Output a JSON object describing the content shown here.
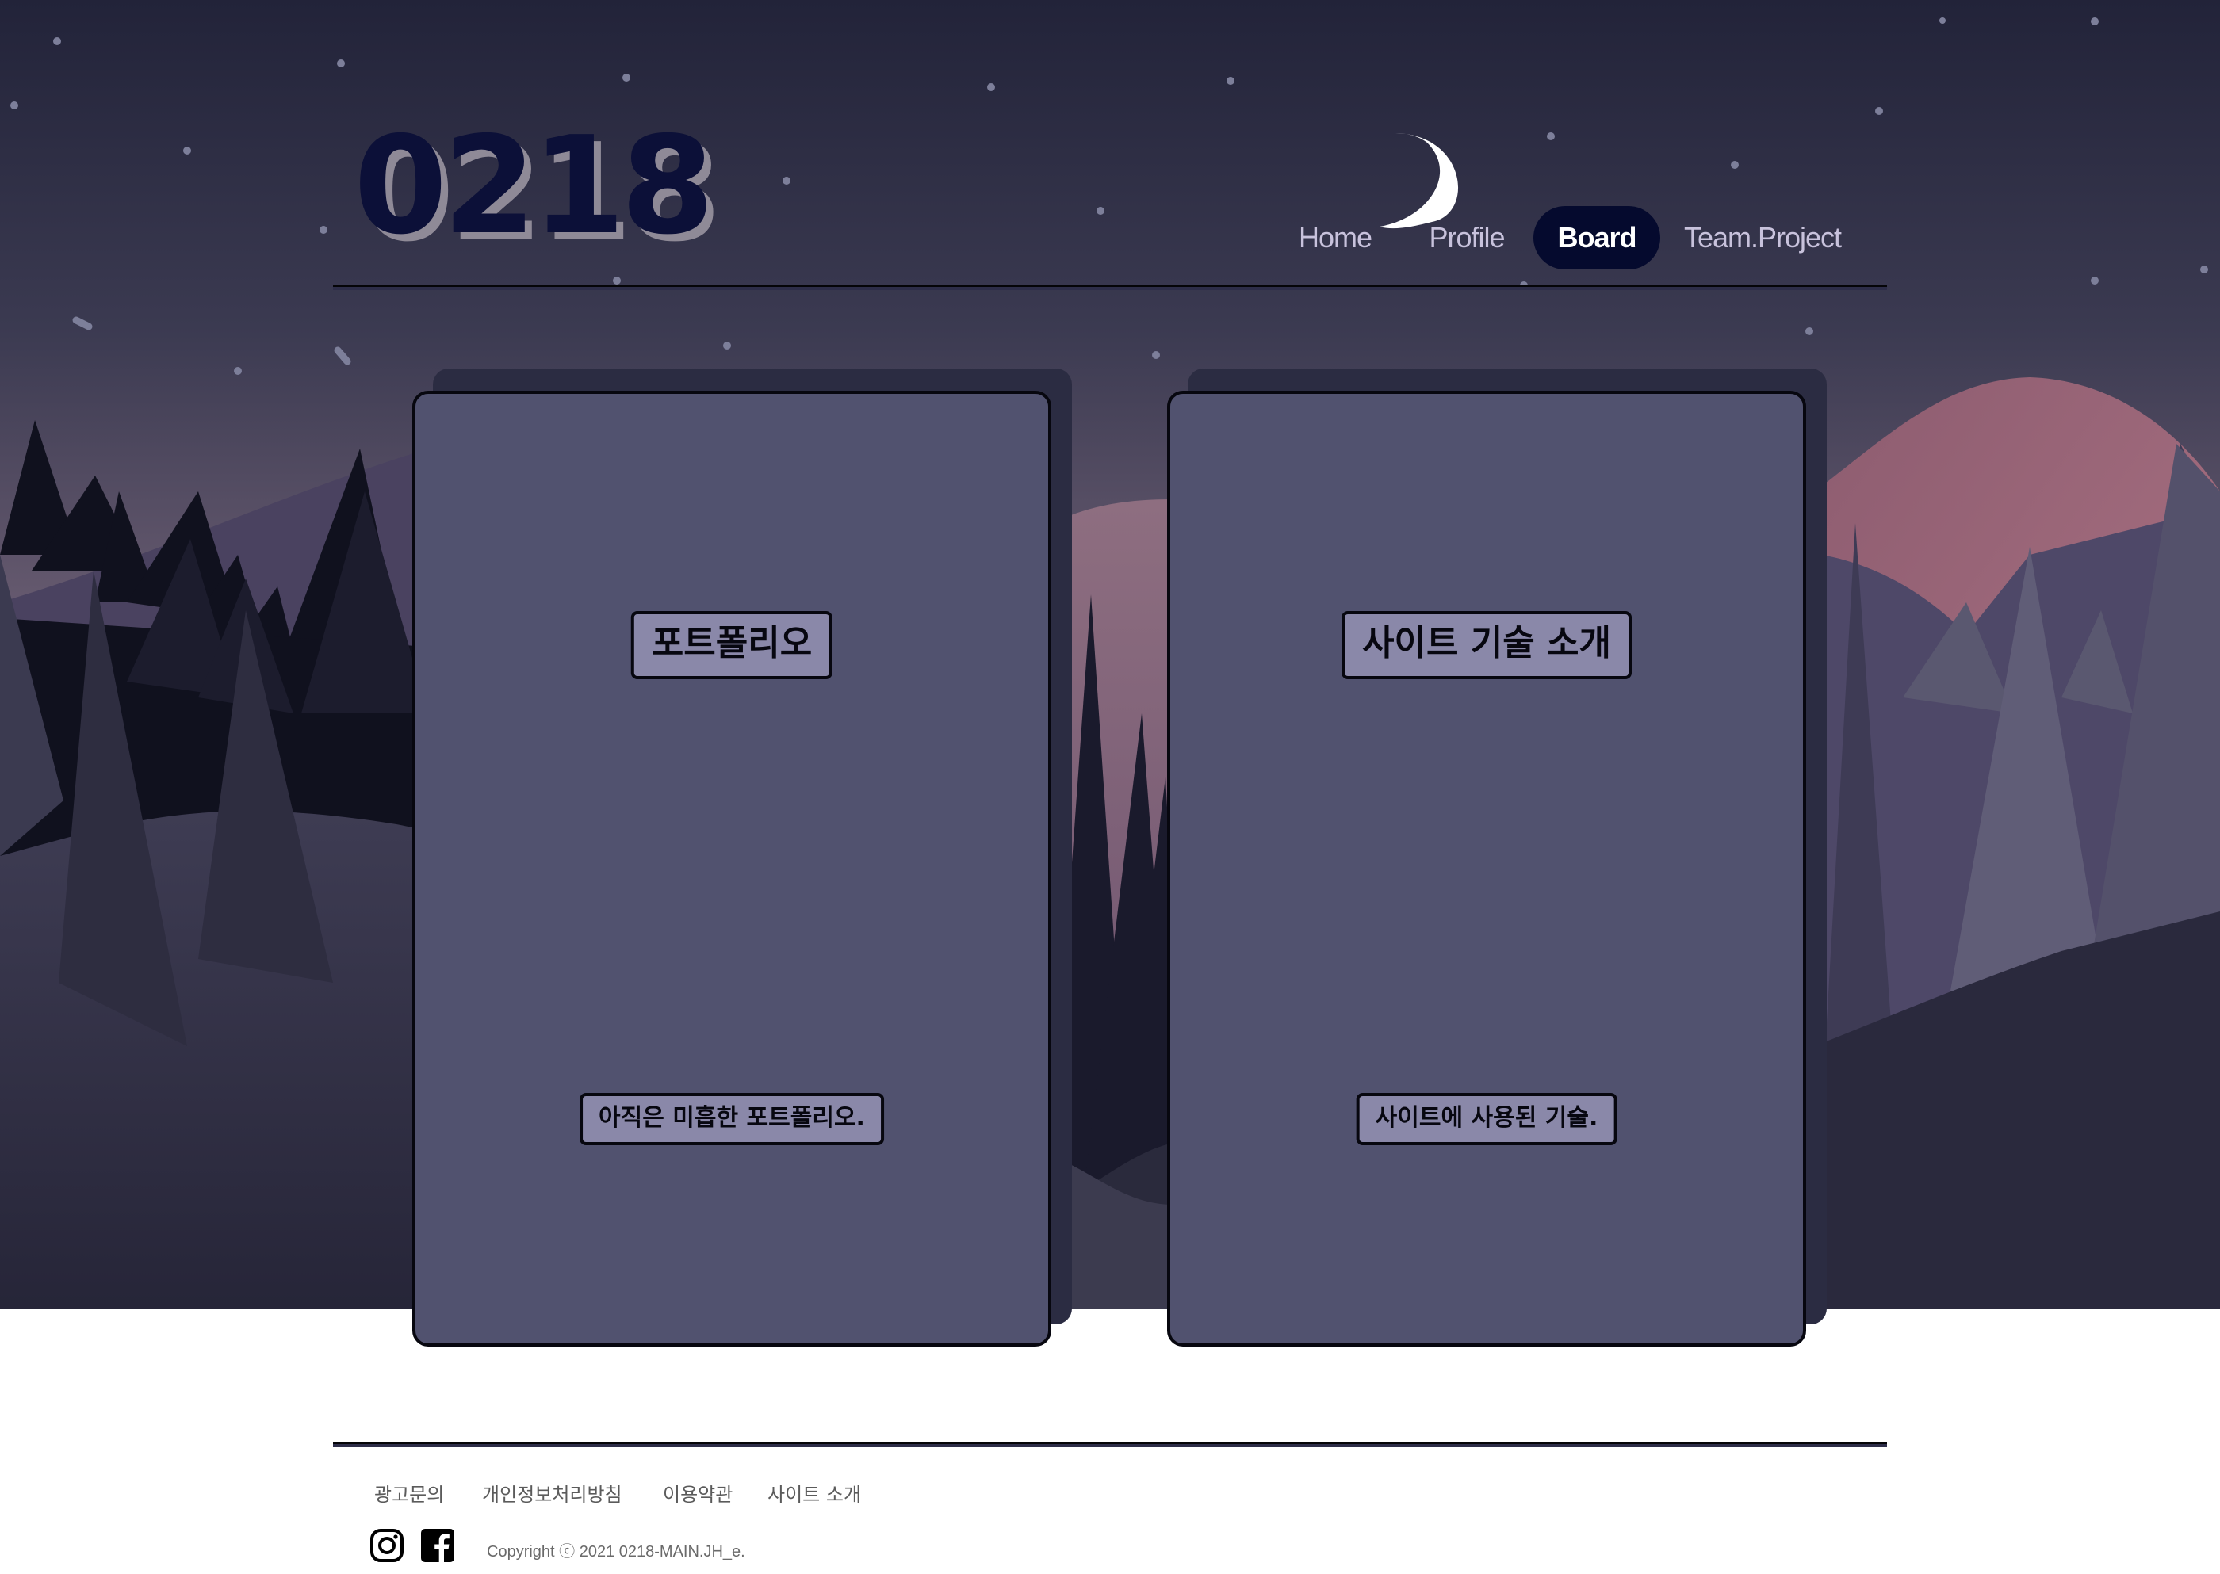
{
  "site": {
    "logo": "0218"
  },
  "nav": {
    "items": [
      {
        "label": "Home",
        "active": false
      },
      {
        "label": "Profile",
        "active": false
      },
      {
        "label": "Board",
        "active": true
      },
      {
        "label": "Team.Project",
        "active": false
      }
    ]
  },
  "cards": [
    {
      "title": "포트폴리오",
      "description": "아직은 미흡한 포트폴리오."
    },
    {
      "title": "사이트 기술 소개",
      "description": "사이트에 사용된 기술."
    }
  ],
  "footer": {
    "links": [
      "광고문의",
      "개인정보처리방침",
      "이용약관",
      "사이트 소개"
    ],
    "social": [
      "instagram-icon",
      "facebook-icon"
    ],
    "copyright": "Copyright ⓒ 2021 0218-MAIN.JH_e."
  },
  "colors": {
    "nav_active_bg": "#050a2e",
    "card_bg": "#51526f",
    "label_bg": "#8a88a9",
    "logo": "#0c1038"
  }
}
